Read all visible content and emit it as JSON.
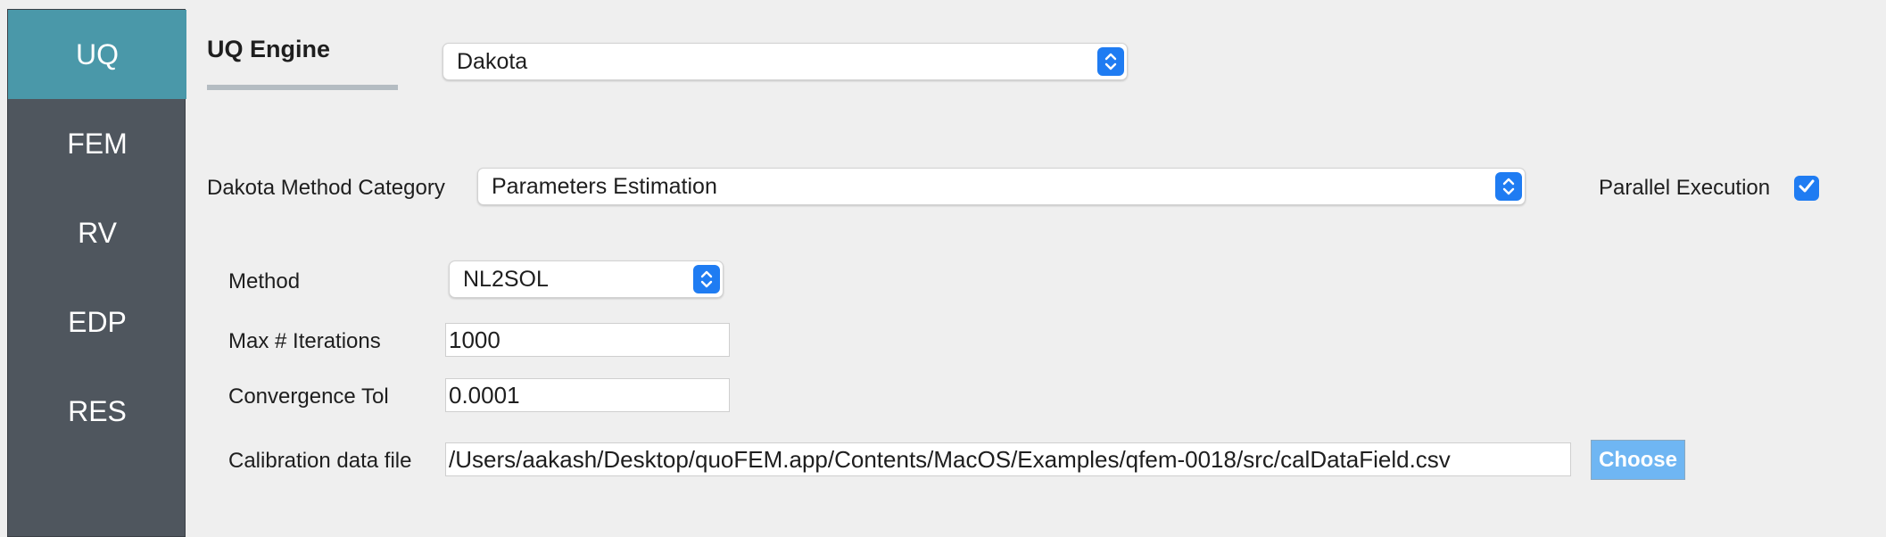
{
  "sidebar": {
    "items": [
      {
        "label": "UQ",
        "active": true
      },
      {
        "label": "FEM"
      },
      {
        "label": "RV"
      },
      {
        "label": "EDP"
      },
      {
        "label": "RES"
      }
    ]
  },
  "engine": {
    "label": "UQ Engine",
    "selected": "Dakota"
  },
  "method_category": {
    "label": "Dakota Method Category",
    "selected": "Parameters Estimation"
  },
  "parallel": {
    "label": "Parallel Execution",
    "checked": true
  },
  "method": {
    "label": "Method",
    "selected": "NL2SOL"
  },
  "max_iterations": {
    "label": "Max # Iterations",
    "value": "1000"
  },
  "convergence_tol": {
    "label": "Convergence Tol",
    "value": "0.0001"
  },
  "calibration_file": {
    "label": "Calibration data file",
    "value": "/Users/aakash/Desktop/quoFEM.app/Contents/MacOS/Examples/qfem-0018/src/calDataField.csv",
    "button_label": "Choose"
  },
  "colors": {
    "sidebar_bg": "#4f565e",
    "sidebar_active": "#4a98a9",
    "accent": "#1f7cf2",
    "choose_button": "#6fb6f3"
  },
  "icons": {
    "select_arrows": "updown-chevron-icon",
    "check": "checkmark-icon"
  }
}
